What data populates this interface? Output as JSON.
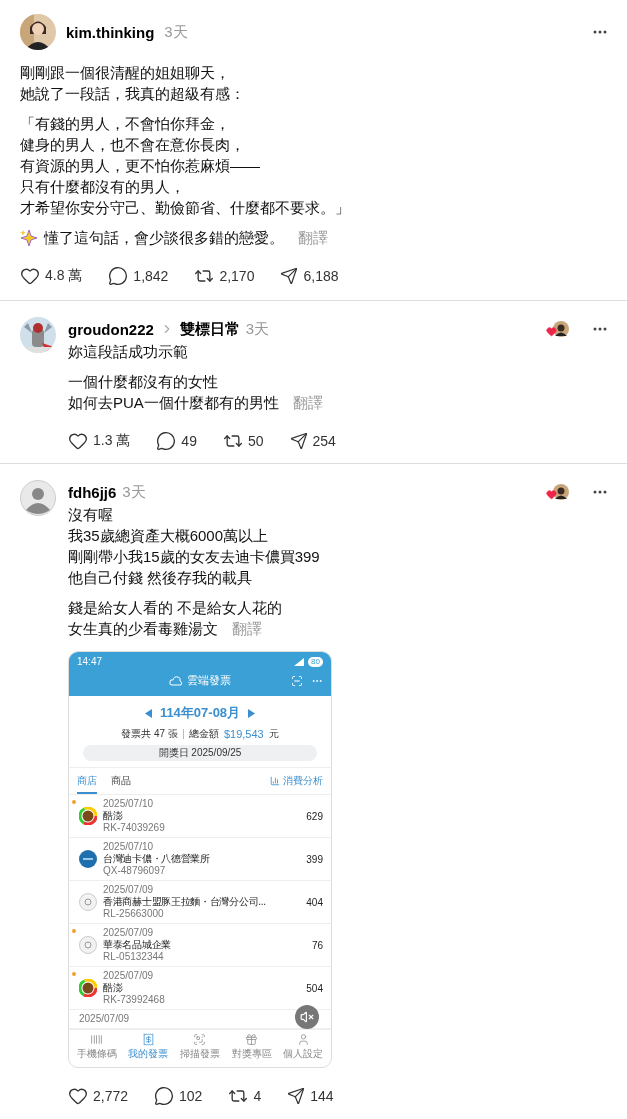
{
  "post": {
    "author": "kim.thinking",
    "time": "3天",
    "paragraphs": [
      [
        "剛剛跟一個很清醒的姐姐聊天，",
        "她說了一段話，我真的超級有感："
      ],
      [
        "「有錢的男人，不會怕你拜金，",
        "健身的男人，也不會在意你長肉，",
        "有資源的男人，更不怕你惹麻煩——",
        "只有什麼都沒有的男人，",
        "才希望你安分守己、勤儉節省、什麼都不要求。」"
      ],
      [
        "懂了這句話，會少談很多錯的戀愛。"
      ]
    ],
    "sparkle_last": true,
    "translate": "翻譯",
    "actions": [
      {
        "kind": "like",
        "count": "4.8 萬"
      },
      {
        "kind": "comment",
        "count": "1,842"
      },
      {
        "kind": "repost",
        "count": "2,170"
      },
      {
        "kind": "share",
        "count": "6,188"
      }
    ]
  },
  "replies": [
    {
      "author": "groudon222",
      "avatar": {
        "kind": "picture"
      },
      "topic": "雙標日常",
      "time": "3天",
      "liked_by_author": true,
      "paragraphs": [
        [
          "妳這段話成功示範"
        ],
        [
          "一個什麼都沒有的女性",
          "如何去PUA一個什麼都有的男性"
        ]
      ],
      "translate": "翻譯",
      "actions": [
        {
          "kind": "like",
          "count": "1.3 萬"
        },
        {
          "kind": "comment",
          "count": "49"
        },
        {
          "kind": "repost",
          "count": "50"
        },
        {
          "kind": "share",
          "count": "254"
        }
      ]
    },
    {
      "author": "fdh6jj6",
      "avatar": {
        "kind": "default"
      },
      "time": "3天",
      "liked_by_author": true,
      "paragraphs": [
        [
          "沒有喔",
          "我35歲總資產大概6000萬以上",
          "剛剛帶小我15歲的女友去迪卡儂買399",
          "他自己付錢 然後存我的載具"
        ],
        [
          "錢是給女人看的 不是給女人花的",
          "女生真的少看毒雞湯文"
        ]
      ],
      "translate": "翻譯",
      "attachment": {
        "kind": "screenshot",
        "status_time": "14:47",
        "battery": "80",
        "title": "雲端發票",
        "period": "114年07-08月",
        "count": "發票共 47 張",
        "total_label": "總金額",
        "total": "$19,543",
        "total_unit": "元",
        "draw_date": "開獎日 2025/09/25",
        "tabs": [
          {
            "label": "商店",
            "selected": true
          },
          {
            "label": "商品",
            "selected": false
          }
        ],
        "analysis": "消費分析",
        "invoices": [
          {
            "date": "2025/07/10",
            "name": "酷澎",
            "number": "RK-74039269",
            "amount": "629",
            "unread": true,
            "kind": "ring"
          },
          {
            "date": "2025/07/10",
            "name": "台灣迪卡儂・八德營業所",
            "number": "QX-48796097",
            "amount": "399",
            "unread": false,
            "kind": "blue"
          },
          {
            "date": "2025/07/09",
            "name": "香港商赫士盟豚王拉麵・台灣分公司...",
            "number": "RL-25663000",
            "amount": "404",
            "unread": false,
            "kind": "grey"
          },
          {
            "date": "2025/07/09",
            "name": "華泰名品城企業",
            "number": "RL-05132344",
            "amount": "76",
            "unread": true,
            "kind": "grey"
          },
          {
            "date": "2025/07/09",
            "name": "酷澎",
            "number": "RK-73992468",
            "amount": "504",
            "unread": true,
            "kind": "ring"
          },
          {
            "date": "2025/07/09"
          }
        ],
        "nav": [
          {
            "label": "手機條碼",
            "selected": false
          },
          {
            "label": "我的發票",
            "selected": true
          },
          {
            "label": "掃描發票",
            "selected": false
          },
          {
            "label": "對獎專區",
            "selected": false
          },
          {
            "label": "個人設定",
            "selected": false
          }
        ],
        "muted": true
      },
      "actions": [
        {
          "kind": "like",
          "count": "2,772"
        },
        {
          "kind": "comment",
          "count": "102"
        },
        {
          "kind": "repost",
          "count": "4"
        },
        {
          "kind": "share",
          "count": "144"
        }
      ]
    }
  ]
}
